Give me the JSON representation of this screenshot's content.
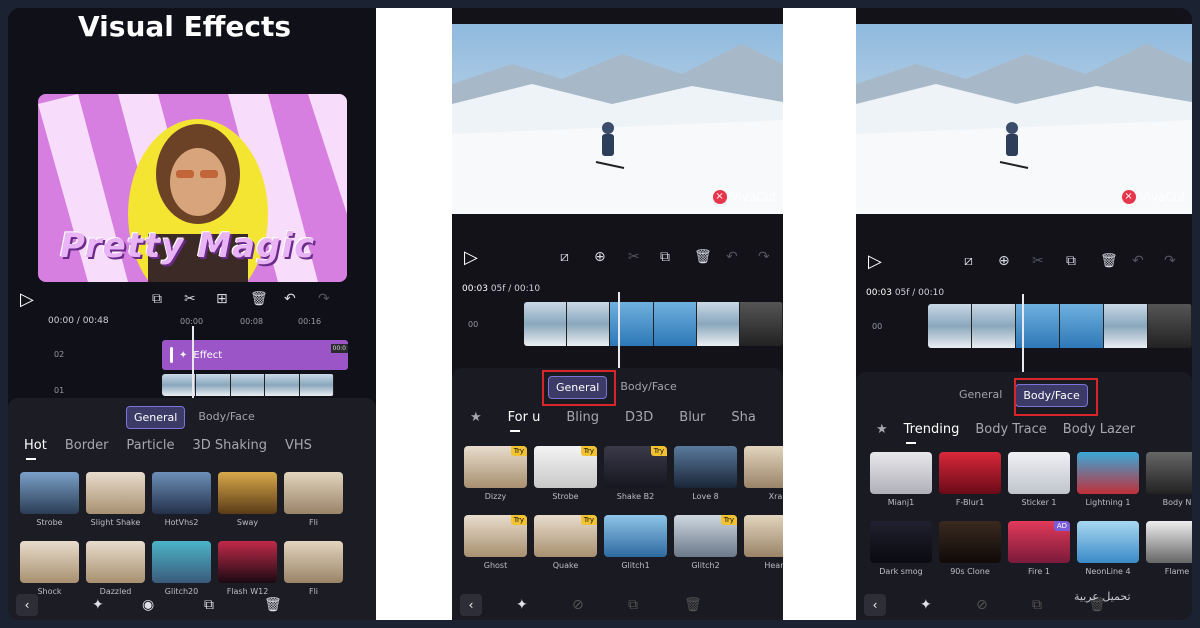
{
  "colors": {
    "accent": "#7c74d8",
    "highlight": "#d8262a",
    "try_badge": "#f2c230",
    "effect_bar": "#9b55c7"
  },
  "panel1": {
    "title": "Visual Effects",
    "preview_text": "Pretty Magic",
    "time": "00:00 / 00:48",
    "ticks": [
      "00:00",
      "00:08",
      "00:16"
    ],
    "track_labels": [
      "02",
      "01"
    ],
    "effect_clip": "Effect",
    "effect_clip_time": "00:0",
    "tabs": [
      "General",
      "Body/Face"
    ],
    "active_tab": "General",
    "categories": [
      "Hot",
      "Border",
      "Particle",
      "3D Shaking",
      "VHS"
    ],
    "effects": [
      "Strobe",
      "Slight Shake",
      "HotVhs2",
      "Sway",
      "Fli",
      "Shock",
      "Dazzled",
      "Glitch20",
      "Flash W12",
      "Fli"
    ]
  },
  "panel2": {
    "time_current": "00:03",
    "time_rest": "05f / 00:10",
    "track_label": "00",
    "watermark": "VivaCut",
    "tabs": [
      "General",
      "Body/Face"
    ],
    "active_tab": "General",
    "categories": [
      "For u",
      "Bling",
      "D3D",
      "Blur",
      "Sha"
    ],
    "effects": [
      "Dizzy",
      "Strobe",
      "Shake B2",
      "Love 8",
      "Xra",
      "Ghost",
      "Quake",
      "Glitch1",
      "Glitch2",
      "Heart"
    ],
    "try_badge": "Try"
  },
  "panel3": {
    "time_current": "00:03",
    "time_rest": "05f / 00:10",
    "track_label": "00",
    "watermark": "VivaCut",
    "tabs": [
      "General",
      "Body/Face"
    ],
    "active_tab": "Body/Face",
    "categories": [
      "Trending",
      "Body Trace",
      "Body Lazer"
    ],
    "effects": [
      "Mianj1",
      "F-Blur1",
      "Sticker 1",
      "Lightning 1",
      "Body N",
      "Dark smog",
      "90s Clone",
      "Fire 1",
      "NeonLine 4",
      "Flame"
    ],
    "ad_badge": "AD"
  },
  "watermark_text": "تحميل عربية"
}
